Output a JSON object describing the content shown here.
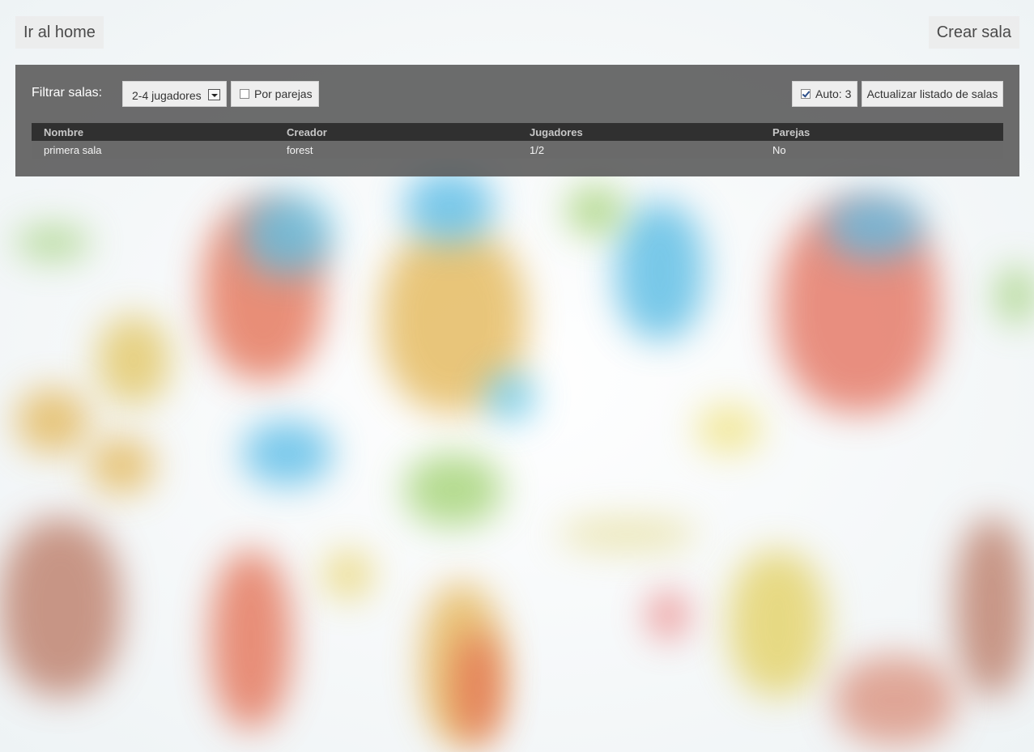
{
  "header": {
    "home_label": "Ir al home",
    "create_label": "Crear sala"
  },
  "filters": {
    "label": "Filtrar salas:",
    "players_selected": "2-4 jugadores",
    "pairs_label": "Por parejas",
    "pairs_checked": false,
    "auto_label": "Auto: 3",
    "auto_checked": true,
    "refresh_label": "Actualizar listado de salas"
  },
  "table": {
    "columns": [
      "Nombre",
      "Creador",
      "Jugadores",
      "Parejas"
    ],
    "rows": [
      [
        "primera sala",
        "forest",
        "1/2",
        "No"
      ]
    ]
  },
  "colors": {
    "panel": "#585858",
    "table_header": "#303030",
    "table_row": "#6a6a6a"
  }
}
